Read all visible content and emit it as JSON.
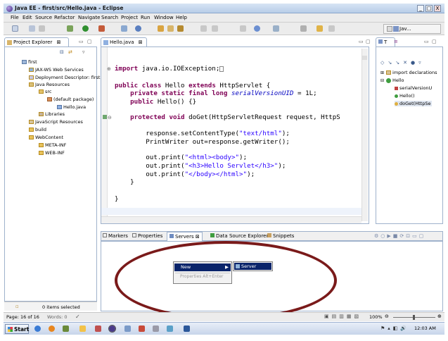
{
  "window": {
    "title": "Java EE - first/src/Hello.java - Eclipse",
    "min": "_",
    "max": "□",
    "close": "X"
  },
  "menu": [
    "File",
    "Edit",
    "Source",
    "Refactor",
    "Navigate",
    "Search",
    "Project",
    "Run",
    "Window",
    "Help"
  ],
  "perspective": {
    "label": "Jav..."
  },
  "project_explorer": {
    "tab": "Project Explorer",
    "items": [
      {
        "label": "first",
        "indent": 0
      },
      {
        "label": "JAX-WS Web Services",
        "indent": 1
      },
      {
        "label": "Deployment Descriptor: first",
        "indent": 1
      },
      {
        "label": "Java Resources",
        "indent": 1
      },
      {
        "label": "src",
        "indent": 2
      },
      {
        "label": "(default package)",
        "indent": 3
      },
      {
        "label": "Hello.java",
        "indent": 4
      },
      {
        "label": "Libraries",
        "indent": 2
      },
      {
        "label": "JavaScript Resources",
        "indent": 1
      },
      {
        "label": "build",
        "indent": 1
      },
      {
        "label": "WebContent",
        "indent": 1
      },
      {
        "label": "META-INF",
        "indent": 2
      },
      {
        "label": "WEB-INF",
        "indent": 2
      }
    ]
  },
  "editor": {
    "tab": "Hello.java",
    "lines": {
      "l1a": "import",
      "l1b": " java.io.IOException;",
      "l2a": "public class",
      "l2b": " Hello ",
      "l2c": "extends",
      "l2d": " HttpServlet {",
      "l3a": "    private static final long ",
      "l3b": "serialVersionUID",
      "l3c": " = 1L;",
      "l4a": "    public",
      "l4b": " Hello() {}",
      "l5a": "    protected void",
      "l5b": " doGet(HttpServletRequest request, HttpS",
      "l6a": "        response.setContentType(",
      "l6b": "\"text/html\"",
      "l6c": ");",
      "l7": "        PrintWriter out=response.getWriter();",
      "l8a": "        out.print(",
      "l8b": "\"<html><body>\"",
      "l8c": ");",
      "l9a": "        out.print(",
      "l9b": "\"<h3>Hello Servlet</h3>\"",
      "l9c": ");",
      "l10a": "        out.print(",
      "l10b": "\"</body></html>\"",
      "l10c": ");",
      "l11": "    }",
      "l12": "}"
    }
  },
  "outline": {
    "tab": "T",
    "items": [
      {
        "label": "import declarations",
        "indent": 0
      },
      {
        "label": "Hello",
        "indent": 0
      },
      {
        "label": "serialVersionU",
        "indent": 1
      },
      {
        "label": "Hello()",
        "indent": 1
      },
      {
        "label": "doGet(HttpSe",
        "indent": 1
      }
    ]
  },
  "bottom_tabs": [
    "Markers",
    "Properties",
    "Servers",
    "Data Source Explorer",
    "Snippets"
  ],
  "context_menu": {
    "new": "New",
    "properties": "Properties   Alt+Enter",
    "submenu_server": "Server"
  },
  "explorer_status": "0 items selected",
  "status": {
    "page": "Page: 16 of 16",
    "words": "Words: 0",
    "zoom": "100%"
  },
  "taskbar": {
    "start": "Start",
    "time": "12:03 AM"
  }
}
